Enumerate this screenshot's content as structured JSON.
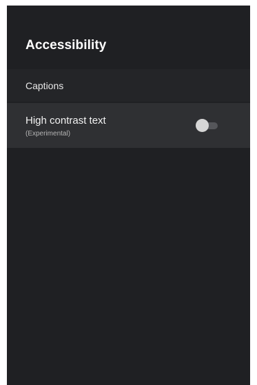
{
  "page": {
    "title": "Accessibility"
  },
  "settings": [
    {
      "label": "Captions"
    },
    {
      "label": "High contrast text",
      "sublabel": "(Experimental)",
      "toggle_on": false
    }
  ],
  "colors": {
    "background": "#1f2023",
    "focused_row": "#2f3033",
    "toggle_thumb_off": "#d6d6d6",
    "toggle_track_off": "#55565a"
  }
}
